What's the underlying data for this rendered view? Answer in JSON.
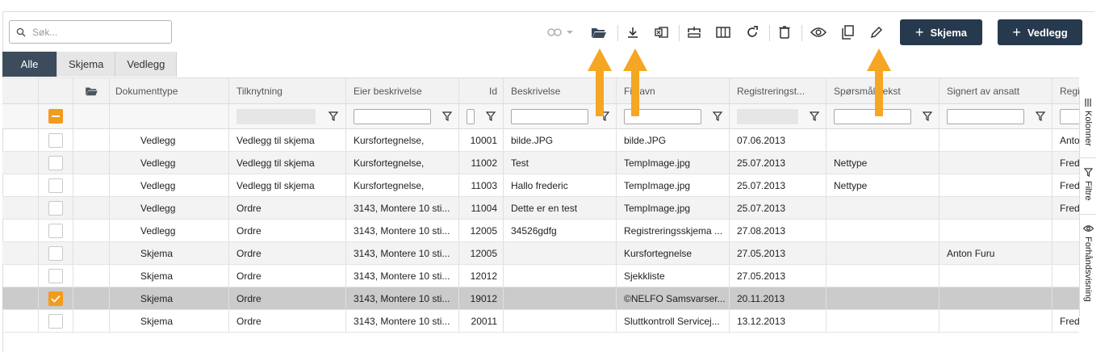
{
  "search": {
    "placeholder": "Søk..."
  },
  "toolbar": {
    "icons": [
      "link-icon",
      "folder-open-icon",
      "download-icon",
      "excel-export-icon",
      "unlink-icon",
      "columns-icon",
      "refresh-icon",
      "delete-icon",
      "eye-icon",
      "copy-icon",
      "edit-icon"
    ],
    "buttons": {
      "schema": "Skjema",
      "attachment": "Vedlegg",
      "plus": "+"
    },
    "accent": "#26394d"
  },
  "tabs": [
    "Alle",
    "Skjema",
    "Vedlegg"
  ],
  "columns": {
    "doc_type": "Dokumenttype",
    "connection": "Tilknytning",
    "owner": "Eier beskrivelse",
    "id": "Id",
    "description": "Beskrivelse",
    "filename": "Filnavn",
    "registered": "Registreringst...",
    "question": "Spørsmålstekst",
    "signed": "Signert av ansatt",
    "extra": "Regi"
  },
  "rows": [
    {
      "type": "Vedlegg",
      "conn": "Vedlegg til skjema",
      "owner": "Kursfortegnelse,",
      "id": "10001",
      "desc": "bilde.JPG",
      "file": "bilde.JPG",
      "date": "07.06.2013",
      "q": "",
      "signed": "",
      "extra": "Anto",
      "checked": false
    },
    {
      "type": "Vedlegg",
      "conn": "Vedlegg til skjema",
      "owner": "Kursfortegnelse,",
      "id": "11002",
      "desc": "Test",
      "file": "TempImage.jpg",
      "date": "25.07.2013",
      "q": "Nettype",
      "signed": "",
      "extra": "Fred",
      "checked": false
    },
    {
      "type": "Vedlegg",
      "conn": "Vedlegg til skjema",
      "owner": "Kursfortegnelse,",
      "id": "11003",
      "desc": "Hallo frederic",
      "file": "TempImage.jpg",
      "date": "25.07.2013",
      "q": "Nettype",
      "signed": "",
      "extra": "Fred",
      "checked": false
    },
    {
      "type": "Vedlegg",
      "conn": "Ordre",
      "owner": "3143, Montere 10 sti...",
      "id": "11004",
      "desc": "Dette er en test",
      "file": "TempImage.jpg",
      "date": "25.07.2013",
      "q": "",
      "signed": "",
      "extra": "Fred",
      "checked": false
    },
    {
      "type": "Vedlegg",
      "conn": "Ordre",
      "owner": "3143, Montere 10 sti...",
      "id": "12005",
      "desc": "34526gdfg",
      "file": "Registreringsskjema ...",
      "date": "27.08.2013",
      "q": "",
      "signed": "",
      "extra": "",
      "checked": false
    },
    {
      "type": "Skjema",
      "conn": "Ordre",
      "owner": "3143, Montere 10 sti...",
      "id": "12005",
      "desc": "",
      "file": "Kursfortegnelse",
      "date": "27.05.2013",
      "q": "",
      "signed": "Anton Furu",
      "extra": "",
      "checked": false
    },
    {
      "type": "Skjema",
      "conn": "Ordre",
      "owner": "3143, Montere 10 sti...",
      "id": "12012",
      "desc": "",
      "file": "Sjekkliste",
      "date": "27.05.2013",
      "q": "",
      "signed": "",
      "extra": "",
      "checked": false
    },
    {
      "type": "Skjema",
      "conn": "Ordre",
      "owner": "3143, Montere 10 sti...",
      "id": "19012",
      "desc": "",
      "file": "©NELFO Samsvarser...",
      "date": "20.11.2013",
      "q": "",
      "signed": "",
      "extra": "",
      "checked": true
    },
    {
      "type": "Skjema",
      "conn": "Ordre",
      "owner": "3143, Montere 10 sti...",
      "id": "20011",
      "desc": "",
      "file": "Sluttkontroll Servicej...",
      "date": "13.12.2013",
      "q": "",
      "signed": "",
      "extra": "Fred",
      "checked": false
    }
  ],
  "side": [
    "Kolonner",
    "Filtre",
    "Forhåndsvisning"
  ],
  "annotation_color": "#f5a623"
}
